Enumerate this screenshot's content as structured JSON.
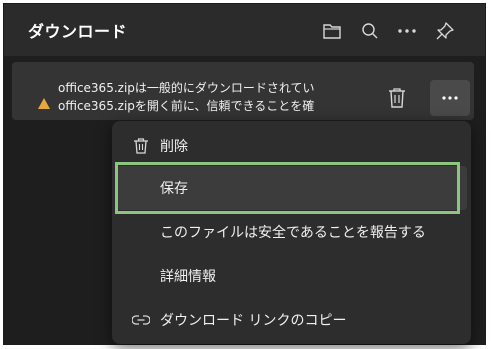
{
  "header": {
    "title": "ダウンロード",
    "icons": [
      "folder-icon",
      "search-icon",
      "more-icon",
      "pin-icon"
    ]
  },
  "download": {
    "line1": "office365.zipは一般的にダウンロードされてい",
    "line2": "office365.zipを開く前に、信頼できることを確",
    "warning_icon": "warning-icon",
    "warning_color": "#e8a93c"
  },
  "menu": {
    "items": [
      {
        "label": "削除",
        "icon": "trash-icon"
      },
      {
        "label": "保存",
        "icon": ""
      },
      {
        "label": "このファイルは安全であることを報告する",
        "icon": ""
      },
      {
        "label": "詳細情報",
        "icon": ""
      },
      {
        "label": "ダウンロード リンクのコピー",
        "icon": "link-icon"
      }
    ]
  },
  "colors": {
    "panel_bg": "#1e1e1e",
    "header_bg": "#2b2b2b",
    "item_bg": "#343434",
    "menu_bg": "#2d2d2d",
    "highlight": "#8dc47f"
  }
}
